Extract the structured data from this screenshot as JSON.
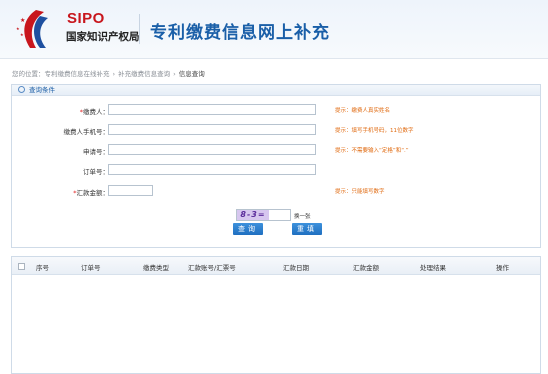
{
  "header": {
    "logo_abbr": "SIPO",
    "logo_org": "国家知识产权局",
    "site_title": "专利缴费信息网上补充"
  },
  "breadcrumb": {
    "prefix": "您的位置：",
    "items": [
      "专利缴费信息在线补充",
      "补充缴费信息查询",
      "信息查询"
    ]
  },
  "query": {
    "section_title": "查询条件",
    "fields": [
      {
        "label": "缴费人：",
        "required": true,
        "value": "",
        "hint": "提示：缴费人真实姓名"
      },
      {
        "label": "缴费人手机号：",
        "required": false,
        "value": "",
        "hint": "提示：填写手机号码，11位数字"
      },
      {
        "label": "申请号：",
        "required": false,
        "value": "",
        "hint": "提示：不需要输入“定格”和“.”"
      },
      {
        "label": "订单号：",
        "required": false,
        "value": "",
        "hint": ""
      },
      {
        "label": "汇款金额：",
        "required": true,
        "value": "",
        "hint": "提示：只能填写数字"
      }
    ],
    "captcha_text": "8-3=",
    "captcha_value": "",
    "refresh_label": "换一张",
    "query_button": "查询",
    "reset_button": "重填"
  },
  "results": {
    "columns": [
      "序号",
      "订单号",
      "缴费类型",
      "汇款账号/汇票号",
      "汇款日期",
      "汇款金额",
      "处理结果",
      "操作"
    ],
    "rows": []
  },
  "colors": {
    "brand_red": "#c8161d",
    "title_blue": "#1a5fa8",
    "hint_orange": "#e06a10",
    "button_blue": "#2a7fd0"
  }
}
